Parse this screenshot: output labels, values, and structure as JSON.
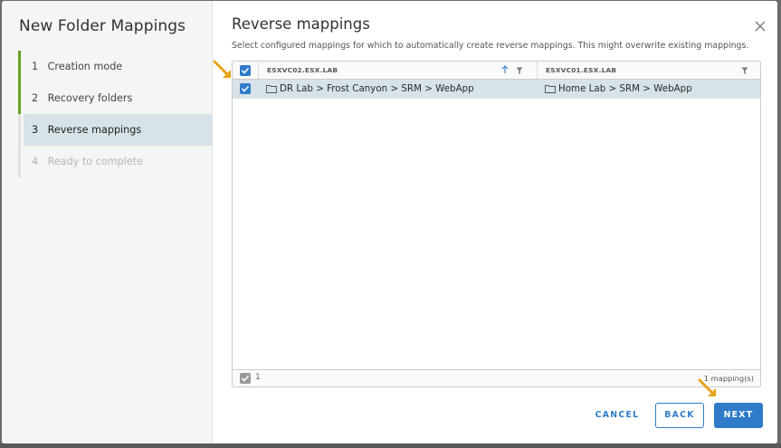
{
  "wizard": {
    "title": "New Folder Mappings",
    "steps": [
      {
        "num": "1",
        "label": "Creation mode"
      },
      {
        "num": "2",
        "label": "Recovery folders"
      },
      {
        "num": "3",
        "label": "Reverse mappings"
      },
      {
        "num": "4",
        "label": "Ready to complete"
      }
    ]
  },
  "page": {
    "title": "Reverse mappings",
    "subtitle": "Select configured mappings for which to automatically create reverse mappings. This might overwrite existing mappings."
  },
  "grid": {
    "columns": [
      "ESXVC02.ESX.LAB",
      "ESXVC01.ESX.LAB"
    ],
    "rows": [
      {
        "source": "DR Lab > Frost Canyon > SRM > WebApp",
        "target": "Home Lab > SRM > WebApp",
        "selected": true
      }
    ],
    "footer": {
      "selected_count": "1",
      "total": "1 mapping(s)"
    }
  },
  "buttons": {
    "cancel": "CANCEL",
    "back": "BACK",
    "next": "NEXT"
  },
  "colors": {
    "accent": "#2f7bc9",
    "done_step": "#62a420",
    "active_step_bg": "#d8e3e9",
    "highlight_arrow": "#e8a317"
  },
  "icons": [
    "close-icon",
    "checkbox-checked-icon",
    "sort-ascending-icon",
    "filter-icon",
    "folder-icon",
    "pointer-arrow-icon"
  ]
}
